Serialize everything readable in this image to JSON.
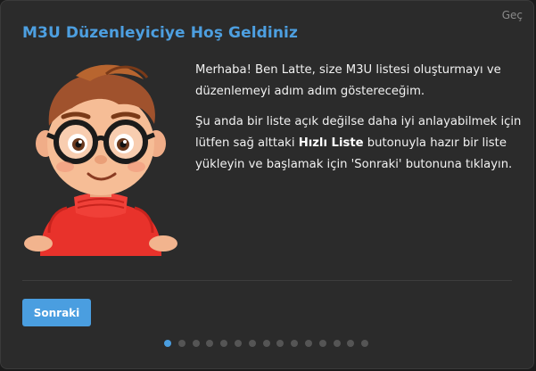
{
  "dialog": {
    "skip_label": "Geç",
    "title": "M3U Düzenleyiciye Hoş Geldiniz",
    "mascot_icon": "latte-mascot-boy-with-glasses",
    "paragraph1": "Merhaba! Ben Latte, size M3U listesi oluşturmayı ve düzenlemeyi adım adım göstereceğim.",
    "paragraph2_before": "Şu anda bir liste açık değilse daha iyi anlayabilmek için lütfen sağ alttaki ",
    "paragraph2_bold": "Hızlı Liste",
    "paragraph2_after": " butonuyla hazır bir liste yükleyin ve başlamak için 'Sonraki' butonuna tıklayın.",
    "next_label": "Sonraki"
  },
  "pagination": {
    "total_steps": 15,
    "current_step": 1
  },
  "colors": {
    "accent": "#4a9ee0",
    "background": "#2b2b2b",
    "text": "#f1f1f1",
    "inactive_dot": "#555555"
  }
}
